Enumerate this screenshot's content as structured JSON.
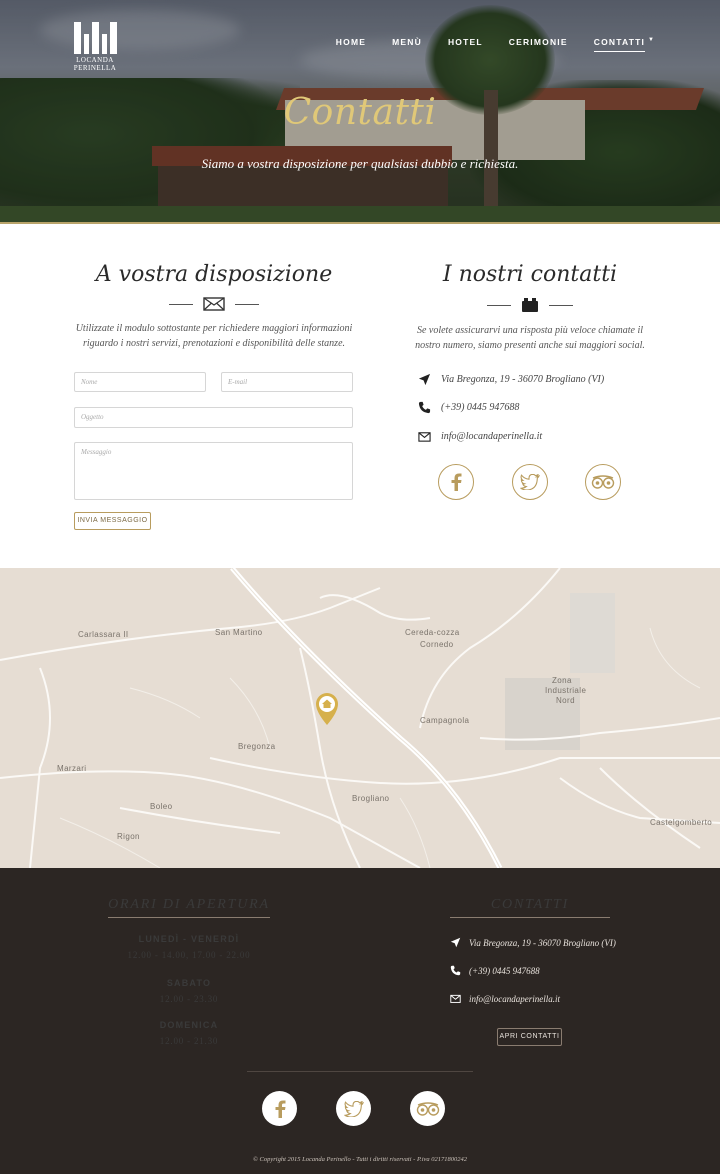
{
  "logo": {
    "line1": "LOCANDA",
    "line2": "PERINELLA"
  },
  "nav": {
    "items": [
      {
        "label": "HOME"
      },
      {
        "label": "MENÙ"
      },
      {
        "label": "HOTEL"
      },
      {
        "label": "CERIMONIE"
      },
      {
        "label": "CONTATTI"
      }
    ],
    "active": "CONTATTI"
  },
  "hero": {
    "title": "Contatti",
    "subtitle": "Siamo a vostra disposizione per qualsiasi dubbio e richiesta."
  },
  "form_section": {
    "title": "A vostra disposizione",
    "intro": "Utilizzate il modulo sottostante per richiedere maggiori informazioni riguardo i nostri servizi, prenotazioni e disponibilità delle stanze.",
    "fields": {
      "name_placeholder": "Nome",
      "email_placeholder": "E-mail",
      "subject_placeholder": "Oggetto",
      "message_placeholder": "Messaggio"
    },
    "submit_label": "INVIA MESSAGGIO"
  },
  "contacts_section": {
    "title": "I nostri contatti",
    "intro": "Se volete assicurarvi una risposta più veloce chiamate il nostro numero, siamo presenti anche sui maggiori social.",
    "address": "Via Bregonza, 19 - 36070 Brogliano (VI)",
    "phone": "(+39) 0445 947688",
    "email": "info@locandaperinella.it",
    "social": [
      "facebook-icon",
      "twitter-icon",
      "tripadvisor-icon"
    ]
  },
  "map": {
    "labels": {
      "san_martino": "San Martino",
      "carlassara": "Carlassara II",
      "bregonza": "Bregonza",
      "campagnola": "Campagnola",
      "brogliano": "Brogliano",
      "marzari": "Marzari",
      "boleo": "Boleo",
      "rigon": "Rigon",
      "castelgomberto": "Castelgomberto",
      "cereda": "Cereda-cozza",
      "cornedo": "Cornedo",
      "zona": "Zona",
      "industriale": "Industriale",
      "nord": "Nord"
    },
    "marker_icon": "home-icon",
    "marker_color": "#d6b04c"
  },
  "footer": {
    "hours_title": "ORARI DI APERTURA",
    "hours": [
      {
        "day": "LUNEDÌ - VENERDÌ",
        "time": "12.00 - 14.00, 17.00 - 22.00"
      },
      {
        "day": "SABATO",
        "time": "12.00 - 23.30"
      },
      {
        "day": "DOMENICA",
        "time": "12.00 - 21.30"
      }
    ],
    "contacts_title": "CONTATTI",
    "address": "Via Bregonza, 19 - 36070 Brogliano (VI)",
    "phone": "(+39) 0445 947688",
    "email": "info@locandaperinella.it",
    "open_contacts_label": "APRI CONTATTI",
    "copyright": "© Copyright 2015 Locanda Perinello - Tutti i diritti riservati - P.iva 02171800242"
  },
  "colors": {
    "gold": "#b89c5e",
    "title_gold": "#e0c878",
    "footer_bg": "#2c2623",
    "map_bg": "#e6ddd3"
  }
}
